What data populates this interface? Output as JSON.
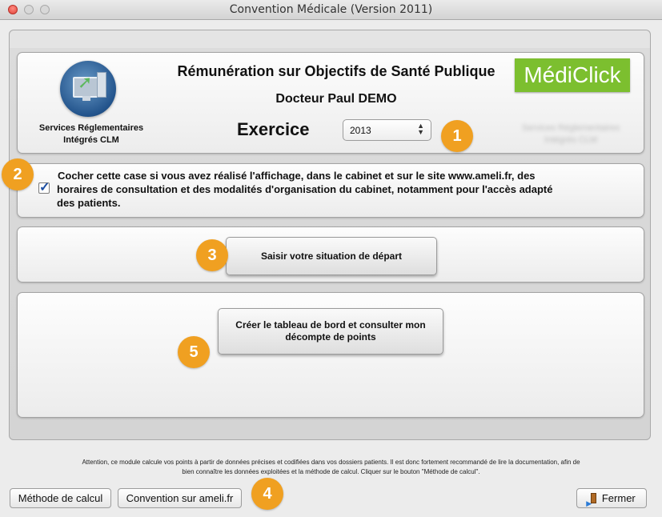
{
  "window": {
    "title": "Convention Médicale (Version 2011)"
  },
  "header": {
    "services_line1": "Services Réglementaires",
    "services_line2": "Intégrés CLM",
    "title": "Rémunération sur Objectifs de Santé Publique",
    "doctor": "Docteur Paul DEMO",
    "exercice_label": "Exercice",
    "exercice_value": "2013",
    "brand": "MédiClick",
    "blurred_line1": "Services Réglementaires",
    "blurred_line2": "Intégrés CLM"
  },
  "checkbox": {
    "checked": true,
    "line1": "Cocher cette case si vous avez réalisé l'affichage, dans le cabinet et sur le site www.ameli.fr,  des",
    "line2": "horaires de consultation et des modalités d'organisation du cabinet, notamment pour l'accès adapté",
    "line3": "des patients."
  },
  "buttons": {
    "start": "Saisir votre situation de départ",
    "board_line1": "Créer le tableau de bord et consulter mon",
    "board_line2": "décompte de points",
    "method": "Méthode de calcul",
    "ameli": "Convention sur ameli.fr",
    "close": "Fermer"
  },
  "notice": {
    "line1": "Attention, ce module calcule vos points à partir de données précises et codifiées dans vos dossiers patients. Il est donc fortement recommandé de lire la documentation, afin de",
    "line2": "bien connaître les données exploitées et la méthode de calcul. Cliquer sur le bouton \"Méthode de calcul\"."
  },
  "badges": [
    "1",
    "2",
    "3",
    "4",
    "5"
  ],
  "colors": {
    "badge": "#f0a021",
    "brand": "#7cbf2f",
    "checkmark": "#1d4fa3"
  }
}
